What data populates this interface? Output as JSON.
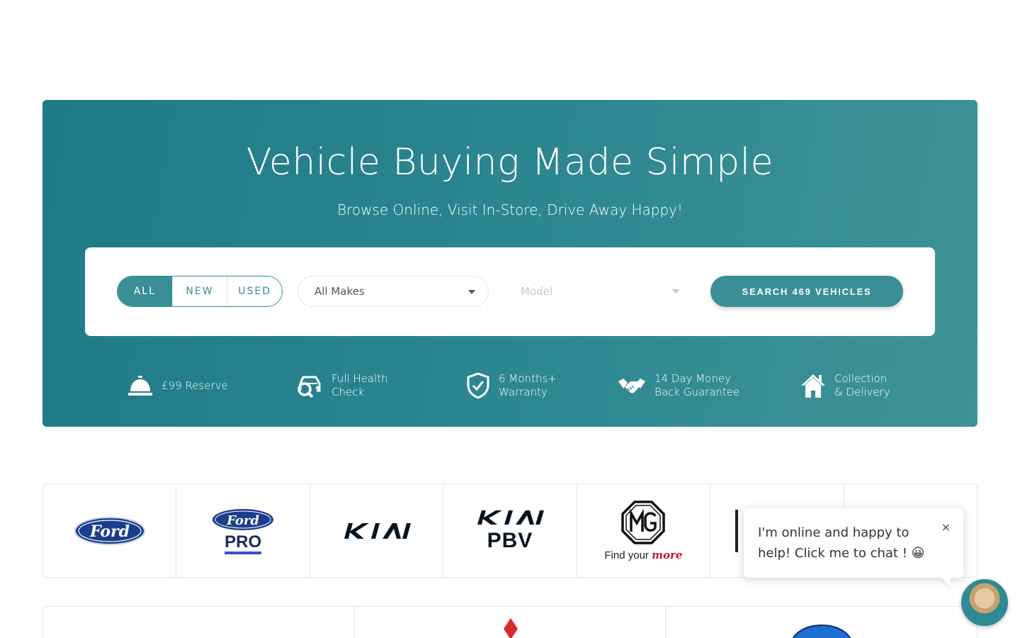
{
  "hero": {
    "title": "Vehicle Buying Made Simple",
    "subtitle": "Browse Online, Visit In-Store, Drive Away Happy!"
  },
  "search": {
    "toggle": [
      "ALL",
      "NEW",
      "USED"
    ],
    "active_toggle": "ALL",
    "makes_value": "All Makes",
    "model_placeholder": "Model",
    "button_label": "SEARCH 469 VEHICLES"
  },
  "features": [
    {
      "icon": "service-bell-icon",
      "line1": "£99 Reserve",
      "line2": ""
    },
    {
      "icon": "car-search-icon",
      "line1": "Full Health",
      "line2": "Check"
    },
    {
      "icon": "shield-check-icon",
      "line1": "6 Months+",
      "line2": "Warranty"
    },
    {
      "icon": "handshake-icon",
      "line1": "14 Day Money",
      "line2": "Back Guarantee"
    },
    {
      "icon": "house-icon",
      "line1": "Collection",
      "line2": "& Delivery"
    }
  ],
  "brands": {
    "ford": "Ford",
    "ford_pro_script": "Ford",
    "ford_pro_text": "PRO",
    "kia": "KIA",
    "kia_pbv_text": "PBV",
    "mg_text": "Find your",
    "mg_script": "more"
  },
  "chat": {
    "message": "I'm online and happy to help! Click me to chat ! 😀",
    "close": "×"
  },
  "colors": {
    "teal": "#3a8e96",
    "hero_start": "#1f7a86",
    "hero_end": "#3f9396",
    "ford_blue": "#1b3e8a",
    "mg_red": "#c8102e"
  }
}
